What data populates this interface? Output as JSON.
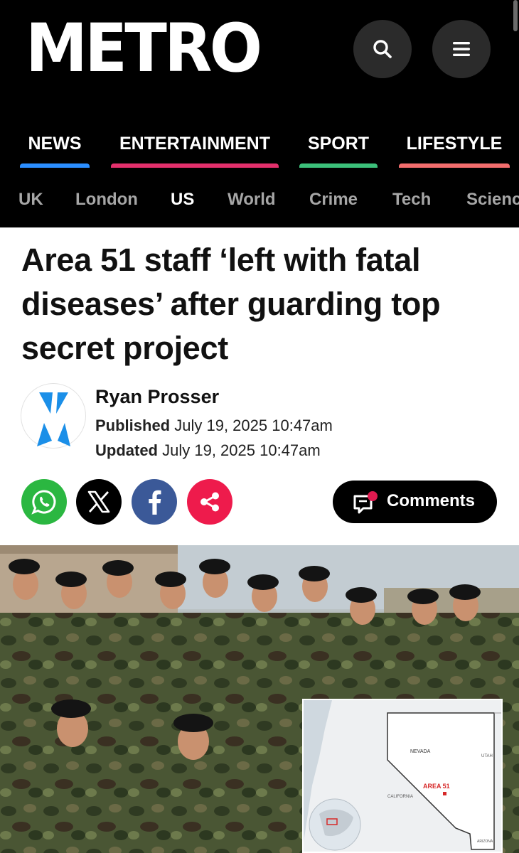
{
  "site": {
    "logo": "METRO"
  },
  "header": {
    "search_icon": "search-icon",
    "menu_icon": "hamburger-menu-icon"
  },
  "sections": [
    {
      "label": "NEWS",
      "color": "#2b8eff"
    },
    {
      "label": "ENTERTAINMENT",
      "color": "#e3306c"
    },
    {
      "label": "SPORT",
      "color": "#3cc07a"
    },
    {
      "label": "LIFESTYLE",
      "color": "#f26d6d"
    }
  ],
  "subnav": [
    "UK",
    "London",
    "US",
    "World",
    "Crime",
    "Tech",
    "Scienc"
  ],
  "subnav_active": "US",
  "article": {
    "headline": "Area 51 staff ‘left with fatal diseases’ after guarding top secret project",
    "author": "Ryan Prosser",
    "published_label": "Published",
    "published_date": "July 19, 2025 10:47am",
    "updated_label": "Updated",
    "updated_date": "July 19, 2025 10:47am"
  },
  "share": {
    "icons": [
      "whatsapp-icon",
      "x-icon",
      "facebook-icon",
      "share-icon"
    ],
    "comments_label": "Comments"
  },
  "hero_map": {
    "state_label": "NEVADA",
    "neighbor_east": "UTAH",
    "neighbor_west": "CALIFORNIA",
    "neighbor_south": "ARIZONA",
    "marker_label": "AREA 51",
    "marker_color": "#d62828"
  }
}
